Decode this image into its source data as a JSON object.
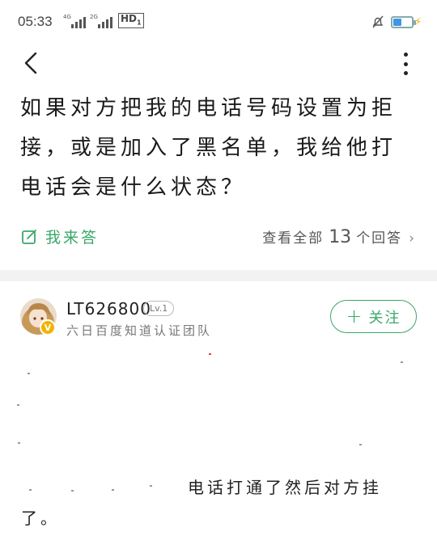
{
  "status_bar": {
    "time": "05:33",
    "signal1_tag": "4G",
    "signal2_tag": "2G",
    "hd_label": "HD",
    "hd_sub": "1",
    "battery_percent": 45,
    "battery_color": "#3f95e8",
    "charging_icon": "lightning-bolt-icon"
  },
  "nav": {
    "back_icon": "chevron-left-icon",
    "more_icon": "more-vertical-icon"
  },
  "question": {
    "title": "如果对方把我的电话号码设置为拒接，或是加入了黑名单，我给他打电话会是什么状态？"
  },
  "actions": {
    "answer_label": "我来答",
    "answer_icon": "edit-icon",
    "view_all_prefix": "查看全部",
    "answer_count": "13",
    "view_all_suffix": "个回答",
    "chevron": "›",
    "accent_color": "#3aa86a"
  },
  "answer": {
    "username": "LT626800",
    "level": "Lv.1",
    "team": "六日百度知道认证团队",
    "verified_badge": "V",
    "follow_label": "关注",
    "follow_plus": "+",
    "text_line1": "电话打通了然后对方挂",
    "text_line2": "了。"
  }
}
